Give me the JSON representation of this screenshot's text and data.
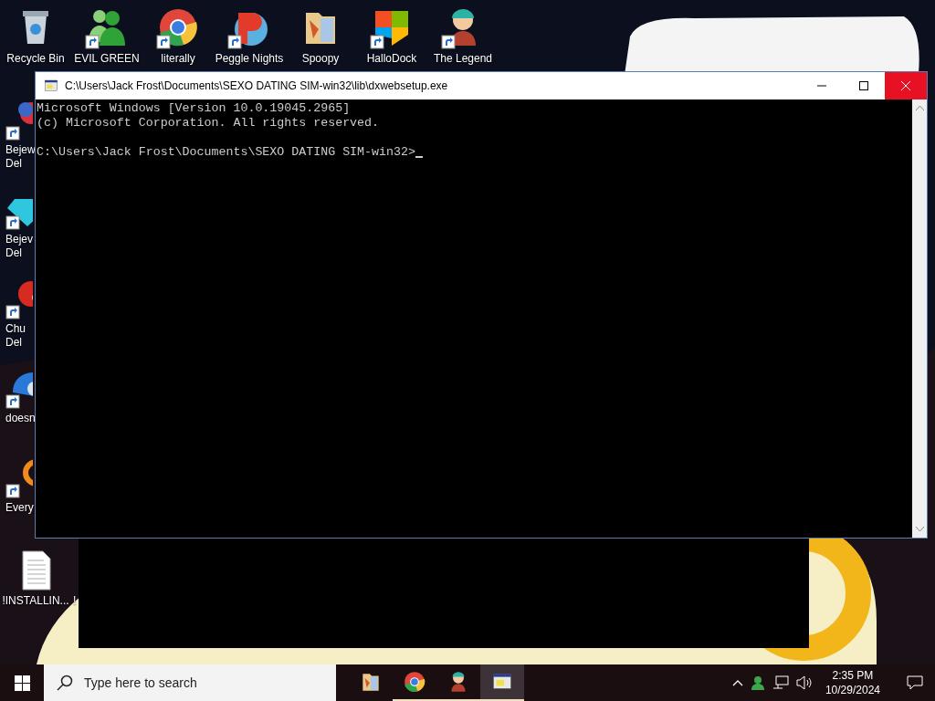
{
  "desktop": {
    "top_row": [
      {
        "kind": "bin",
        "lines": [
          "Recycle Bin"
        ],
        "shortcut": false
      },
      {
        "kind": "people",
        "lines": [
          "EVIL GREEN"
        ],
        "shortcut": true
      },
      {
        "kind": "browser",
        "lines": [
          "literally"
        ],
        "shortcut": true
      },
      {
        "kind": "ball",
        "lines": [
          "Peggle Nights"
        ],
        "shortcut": true
      },
      {
        "kind": "folder",
        "lines": [
          "Spoopy"
        ],
        "shortcut": false
      },
      {
        "kind": "shield",
        "lines": [
          "HalloDock"
        ],
        "shortcut": true
      },
      {
        "kind": "figure",
        "lines": [
          "The Legend"
        ],
        "shortcut": true
      }
    ],
    "left_column": [
      {
        "kind": "blob",
        "lines": [
          "Bejew",
          "Del"
        ],
        "shortcut": true
      },
      {
        "kind": "gem",
        "lines": [
          "Bejev",
          "Del"
        ],
        "shortcut": true
      },
      {
        "kind": "creature",
        "lines": [
          "Chu",
          "Del"
        ],
        "shortcut": true
      },
      {
        "kind": "bird",
        "lines": [
          "doesn"
        ],
        "shortcut": true
      },
      {
        "kind": "ring",
        "lines": [
          "Every"
        ],
        "shortcut": true
      }
    ],
    "bottom_row": [
      {
        "kind": "document",
        "lines": [
          "!INSTALLIN..."
        ]
      },
      {
        "kind": "hidden",
        "lines": [
          "!"
        ]
      }
    ]
  },
  "window": {
    "title": "C:\\Users\\Jack Frost\\Documents\\SEXO DATING SIM-win32\\lib\\dxwebsetup.exe",
    "focused": true,
    "lines": [
      "Microsoft Windows [Version 10.0.19045.2965]",
      "(c) Microsoft Corporation. All rights reserved."
    ],
    "prompt": "C:\\Users\\Jack Frost\\Documents\\SEXO DATING SIM-win32>",
    "cursor": true
  },
  "taskbar": {
    "search": {
      "placeholder": "Type here to search"
    },
    "apps": [
      {
        "kind": "folder",
        "selected": false,
        "running": false
      },
      {
        "kind": "browser",
        "selected": false,
        "running": true
      },
      {
        "kind": "figure",
        "selected": false,
        "running": true
      },
      {
        "kind": "terminal",
        "selected": true,
        "running": true
      }
    ],
    "clock": {
      "time": "2:35 PM",
      "date": "10/29/2024"
    }
  }
}
